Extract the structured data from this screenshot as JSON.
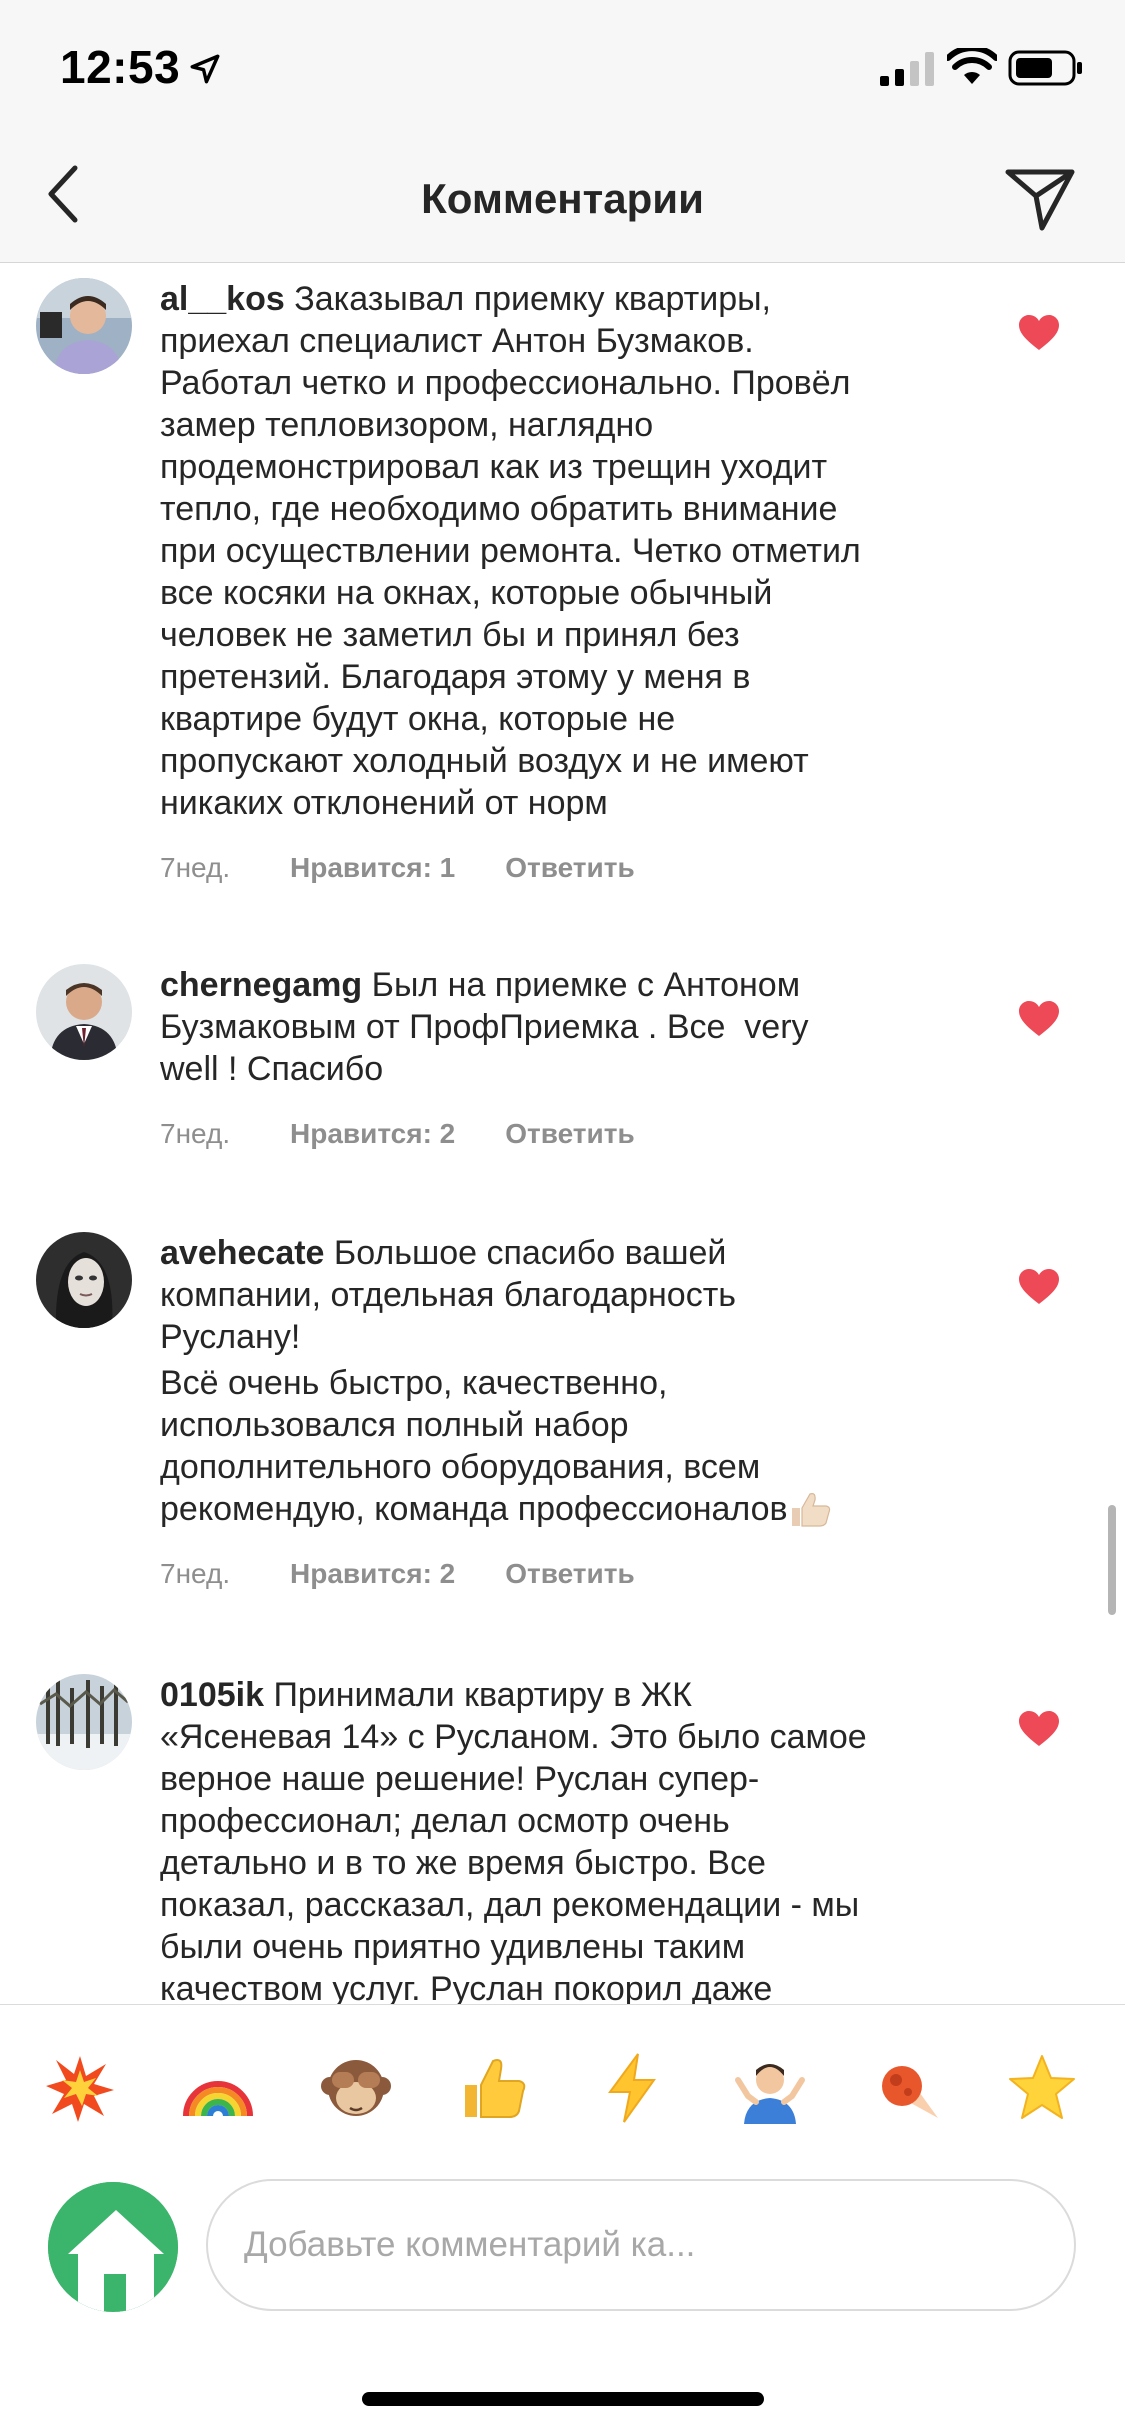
{
  "status_bar": {
    "time": "12:53"
  },
  "header": {
    "title": "Комментарии"
  },
  "comments": [
    {
      "username": "al__kos",
      "lines": [
        " Заказывал приемку квартиры,",
        "приехал специалист Антон Бузмаков.",
        "Работал четко и профессионально. Провёл",
        "замер тепловизором, наглядно",
        "продемонстрировал как из трещин уходит",
        "тепло, где необходимо обратить внимание",
        "при осуществлении ремонта. Четко отметил",
        "все косяки на окнах, которые обычный",
        "человек не заметил бы и принял без",
        "претензий. Благодаря этому у меня в",
        "квартире будут окна, которые не",
        "пропускают холодный воздух и не имеют",
        "никаких отклонений от норм"
      ],
      "time": "7нед.",
      "likes": "Нравится: 1",
      "reply": "Ответить"
    },
    {
      "username": "chernegamg",
      "lines": [
        " Был на приемке с Антоном",
        "Бузмаковым от ПрофПриемка . Все  very",
        "well ! Спасибо"
      ],
      "time": "7нед.",
      "likes": "Нравится: 2",
      "reply": "Ответить"
    },
    {
      "username": "avehecate",
      "lines": [
        " Большое спасибо вашей",
        "компании, отдельная благодарность",
        "Руслану!",
        "Всё очень быстро, качественно,",
        "использовался полный набор",
        "дополнительного оборудования, всем",
        "рекомендую, команда профессионалов"
      ],
      "time": "7нед.",
      "likes": "Нравится: 2",
      "reply": "Ответить"
    },
    {
      "username": "0105ik",
      "lines": [
        " Принимали квартиру в ЖК",
        "«Ясеневая 14» с Русланом. Это было самое",
        "верное наше решение! Руслан супер-",
        "профессионал; делал осмотр очень",
        "детально и в то же время быстро. Все",
        "показал, рассказал, дал рекомендации - мы",
        "были очень приятно удивлены таким",
        "качеством услуг. Руслан покорил даже"
      ]
    }
  ],
  "emoji_bar": [
    "collision-icon",
    "rainbow-icon",
    "see-no-evil-monkey-icon",
    "thumbs-up-icon",
    "lightning-icon",
    "shrug-icon",
    "comet-icon",
    "star-icon"
  ],
  "composer": {
    "placeholder": "Добавьте комментарий ка..."
  },
  "colors": {
    "heart": "#ed4956",
    "meta": "#8e8e8e",
    "text": "#262626",
    "avatar_green": "#3bb56b"
  }
}
